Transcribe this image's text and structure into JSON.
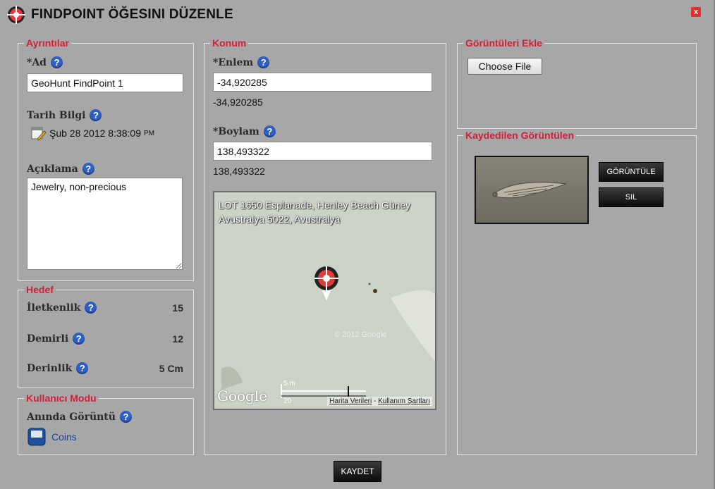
{
  "window": {
    "title": "FINDPOINT ÖĞESINI DÜZENLE",
    "close_label": "x"
  },
  "details": {
    "legend": "Ayrıntılar",
    "name_label": "*Ad",
    "name_value": "GeoHunt FindPoint 1",
    "date_label": "Tarih Bilgi",
    "date_value": "Şub 28 2012 8:38:09",
    "date_suffix": "PM",
    "desc_label": "Açıklama",
    "desc_value": "Jewelry, non-precious"
  },
  "target": {
    "legend": "Hedef",
    "rows": [
      {
        "label": "İletkenlik",
        "value": "15"
      },
      {
        "label": "Demirli",
        "value": "12"
      },
      {
        "label": "Derinlik",
        "value": "5 Cm"
      }
    ]
  },
  "user_mode": {
    "legend": "Kullanıcı Modu",
    "instant_label": "Anında Görüntü",
    "mode_value": "Coins"
  },
  "location": {
    "legend": "Konum",
    "lat_label": "*Enlem",
    "lat_value": "-34,920285",
    "lat_display": "-34,920285",
    "lon_label": "*Boylam",
    "lon_value": "138,493322",
    "lon_display": "138,493322",
    "map": {
      "address": "LOT 1650 Esplanade, Henley Beach Güney Avustralya 5022, Avustralya",
      "google_logo": "Google",
      "scale_label": "5 m",
      "scale_label2": "20",
      "terms_data": "Harita Verileri",
      "terms_sep": " - ",
      "terms_use": "Kullanım Şartları",
      "watermark": "© 2012 Google"
    }
  },
  "images_add": {
    "legend": "Görüntüleri Ekle",
    "choose_file": "Choose File"
  },
  "saved_images": {
    "legend": "Kaydedilen Görüntülen",
    "view_button": "GÖRÜNTÜLE",
    "delete_button": "SIL"
  },
  "footer": {
    "save_button": "KAYDET"
  },
  "colors": {
    "legend": "#d0203a",
    "help": "#2f5fc4",
    "background": "#a7a7a7"
  },
  "icons": {
    "title": "crosshair-logo-icon",
    "help": "help-icon",
    "calendar": "calendar-edit-icon",
    "mode": "floppy-icon",
    "marker": "map-marker-icon",
    "close": "close-icon"
  }
}
